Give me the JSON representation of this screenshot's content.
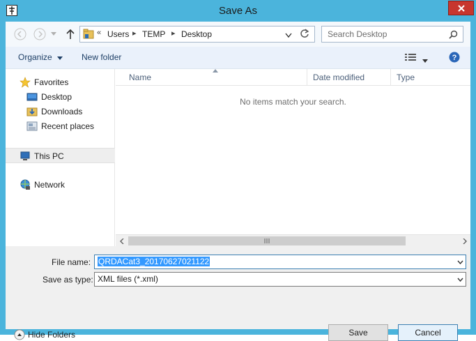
{
  "window": {
    "title": "Save As",
    "accent_color": "#4bb4dc",
    "close_color": "#c7362e"
  },
  "address": {
    "overflow": "«",
    "crumbs": [
      "Users",
      "TEMP",
      "Desktop"
    ],
    "search_placeholder": "Search Desktop"
  },
  "commands": {
    "organize": "Organize",
    "new_folder": "New folder"
  },
  "nav": {
    "favorites": "Favorites",
    "desktop": "Desktop",
    "downloads": "Downloads",
    "recent": "Recent places",
    "this_pc": "This PC",
    "network": "Network"
  },
  "list": {
    "columns": [
      "Name",
      "Date modified",
      "Type"
    ],
    "empty_message": "No items match your search."
  },
  "form": {
    "file_name_label": "File name:",
    "file_name_value": "QRDACat3_20170627021122",
    "save_type_label": "Save as type:",
    "save_type_value": "XML files (*.xml)"
  },
  "buttons": {
    "hide_folders": "Hide Folders",
    "save": "Save",
    "cancel": "Cancel"
  },
  "icons": {
    "back": "back-arrow-icon",
    "forward": "forward-arrow-icon",
    "up": "up-arrow-icon",
    "refresh": "refresh-icon",
    "search": "magnifier-icon",
    "view": "view-details-icon",
    "help": "help-icon"
  }
}
